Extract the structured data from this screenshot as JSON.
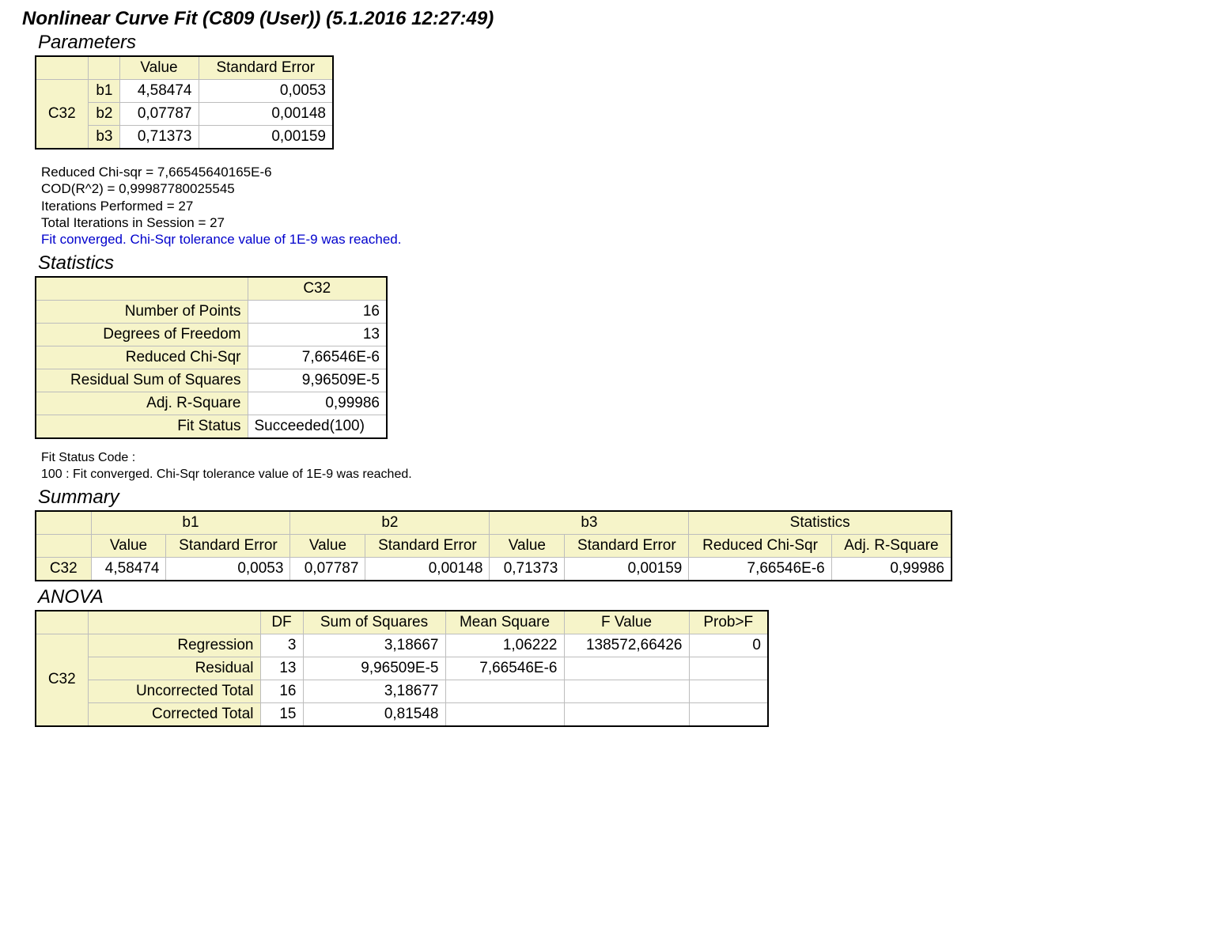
{
  "title": "Nonlinear Curve Fit (C809 (User)) (5.1.2016 12:27:49)",
  "sections": {
    "parameters": "Parameters",
    "statistics": "Statistics",
    "summary": "Summary",
    "anova": "ANOVA"
  },
  "params": {
    "headers": {
      "value": "Value",
      "stderr": "Standard Error"
    },
    "rowgroup": "C32",
    "rows": [
      {
        "name": "b1",
        "value": "4,58474",
        "stderr": "0,0053"
      },
      {
        "name": "b2",
        "value": "0,07787",
        "stderr": "0,00148"
      },
      {
        "name": "b3",
        "value": "0,71373",
        "stderr": "0,00159"
      }
    ]
  },
  "notes": {
    "l1": "Reduced Chi-sqr = 7,66545640165E-6",
    "l2": "COD(R^2) = 0,99987780025545",
    "l3": "Iterations Performed = 27",
    "l4": "Total Iterations in Session = 27",
    "converged": "Fit converged. Chi-Sqr tolerance value of 1E-9 was reached."
  },
  "stats": {
    "col": "C32",
    "rows": [
      {
        "label": "Number of Points",
        "value": "16"
      },
      {
        "label": "Degrees of Freedom",
        "value": "13"
      },
      {
        "label": "Reduced Chi-Sqr",
        "value": "7,66546E-6"
      },
      {
        "label": "Residual Sum of Squares",
        "value": "9,96509E-5"
      },
      {
        "label": "Adj. R-Square",
        "value": "0,99986"
      },
      {
        "label": "Fit Status",
        "value": "Succeeded(100)"
      }
    ]
  },
  "fitstatus_note": {
    "l1": "Fit Status Code :",
    "l2": "100 : Fit converged. Chi-Sqr tolerance value of 1E-9 was reached."
  },
  "summary": {
    "groups": {
      "b1": "b1",
      "b2": "b2",
      "b3": "b3",
      "stats": "Statistics"
    },
    "sub": {
      "value": "Value",
      "stderr": "Standard Error",
      "rcs": "Reduced Chi-Sqr",
      "ars": "Adj. R-Square"
    },
    "row": {
      "name": "C32",
      "b1v": "4,58474",
      "b1e": "0,0053",
      "b2v": "0,07787",
      "b2e": "0,00148",
      "b3v": "0,71373",
      "b3e": "0,00159",
      "rcs": "7,66546E-6",
      "ars": "0,99986"
    }
  },
  "anova": {
    "headers": {
      "df": "DF",
      "ss": "Sum of Squares",
      "ms": "Mean Square",
      "f": "F Value",
      "p": "Prob>F"
    },
    "rowgroup": "C32",
    "rows": [
      {
        "label": "Regression",
        "df": "3",
        "ss": "3,18667",
        "ms": "1,06222",
        "f": "138572,66426",
        "p": "0"
      },
      {
        "label": "Residual",
        "df": "13",
        "ss": "9,96509E-5",
        "ms": "7,66546E-6",
        "f": "",
        "p": ""
      },
      {
        "label": "Uncorrected Total",
        "df": "16",
        "ss": "3,18677",
        "ms": "",
        "f": "",
        "p": ""
      },
      {
        "label": "Corrected Total",
        "df": "15",
        "ss": "0,81548",
        "ms": "",
        "f": "",
        "p": ""
      }
    ]
  }
}
